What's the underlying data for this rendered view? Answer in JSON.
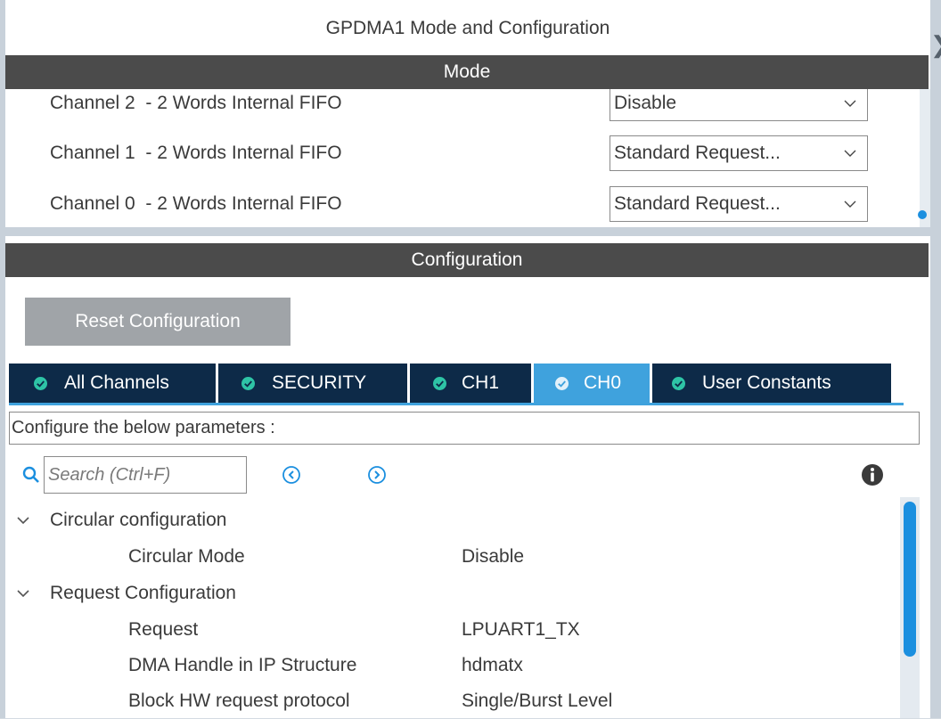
{
  "window": {
    "title": "GPDMA1 Mode and Configuration"
  },
  "mode": {
    "header": "Mode",
    "rows": [
      {
        "label": "Channel 2  - 2 Words Internal FIFO",
        "value": "Disable"
      },
      {
        "label": "Channel 1  - 2 Words Internal FIFO",
        "value": "Standard Request..."
      },
      {
        "label": "Channel 0  - 2 Words Internal FIFO",
        "value": "Standard Request..."
      }
    ]
  },
  "configuration": {
    "header": "Configuration",
    "reset_label": "Reset Configuration",
    "tabs": [
      {
        "label": "All Channels",
        "active": false
      },
      {
        "label": "SECURITY",
        "active": false
      },
      {
        "label": "CH1",
        "active": false
      },
      {
        "label": "CH0",
        "active": true
      },
      {
        "label": "User Constants",
        "active": false
      }
    ],
    "params_label": "Configure the below parameters :",
    "search_placeholder": "Search (Ctrl+F)",
    "groups": [
      {
        "label": "Circular configuration",
        "params": [
          {
            "name": "Circular Mode",
            "value": "Disable"
          }
        ]
      },
      {
        "label": "Request Configuration",
        "params": [
          {
            "name": "Request",
            "value": "LPUART1_TX"
          },
          {
            "name": "DMA Handle in IP Structure",
            "value": "hdmatx"
          },
          {
            "name": "Block HW request protocol",
            "value": "Single/Burst Level"
          }
        ]
      }
    ]
  },
  "icons": {
    "tab_check": "check-circle-icon",
    "search": "search-icon",
    "prev": "chevron-left-circle-icon",
    "next": "chevron-right-circle-icon",
    "info": "info-icon",
    "group_toggle": "chevron-down-icon"
  },
  "colors": {
    "header_bar": "#4b4b4b",
    "tab_bg": "#0d2a48",
    "tab_active": "#3fa2dd",
    "accent": "#1b8fdf",
    "check": "#2ec4a6",
    "button": "#a0a4a8"
  }
}
